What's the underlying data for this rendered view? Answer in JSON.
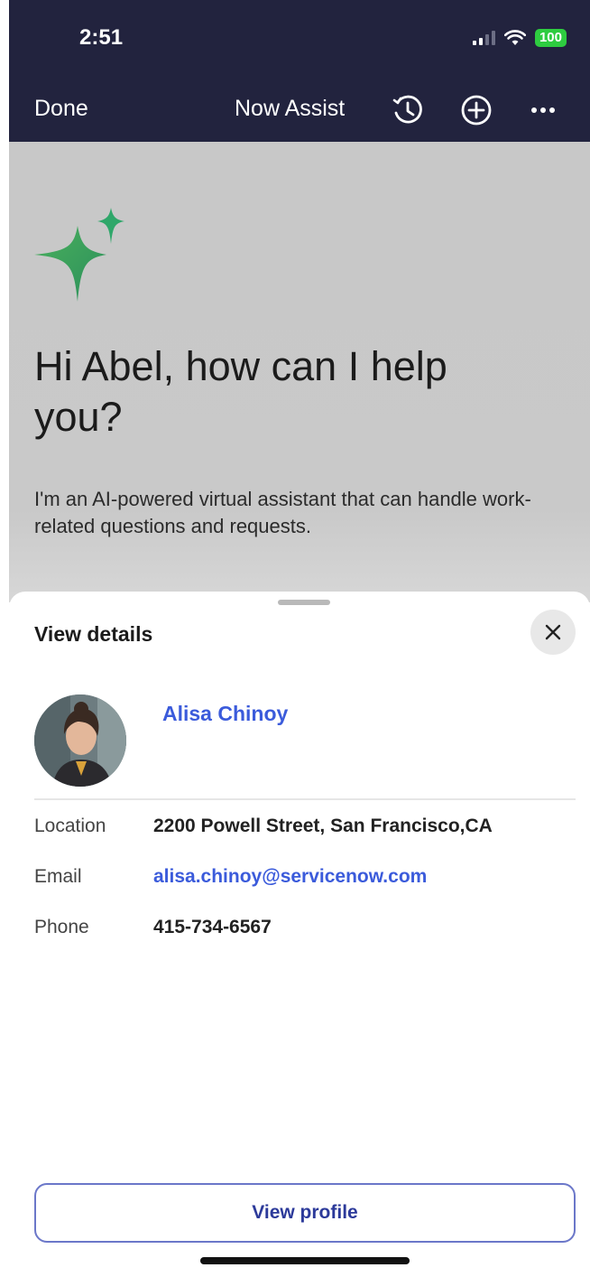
{
  "status_bar": {
    "time": "2:51",
    "battery": "100"
  },
  "nav": {
    "done_label": "Done",
    "title": "Now Assist"
  },
  "assistant": {
    "greeting": "Hi Abel, how can I help you?",
    "intro": "I'm an AI-powered virtual assistant that can handle work-related questions and requests."
  },
  "sheet": {
    "title": "View details",
    "person_name": "Alisa Chinoy",
    "rows": [
      {
        "label": "Location",
        "value": "2200 Powell Street, San Francisco,CA"
      },
      {
        "label": "Email",
        "value": "alisa.chinoy@servicenow.com"
      },
      {
        "label": "Phone",
        "value": "415-734-6567"
      }
    ],
    "profile_button": "View profile"
  },
  "colors": {
    "nav_bg": "#22233e",
    "link": "#3b5bdb",
    "battery": "#2ecc40",
    "sparkle_green": "#3aa757",
    "sparkle_teal": "#2a9d8f"
  },
  "icons": [
    "history-icon",
    "add-circle-icon",
    "more-icon",
    "close-icon",
    "sparkle-icon",
    "wifi-icon",
    "signal-icon",
    "battery-icon"
  ]
}
